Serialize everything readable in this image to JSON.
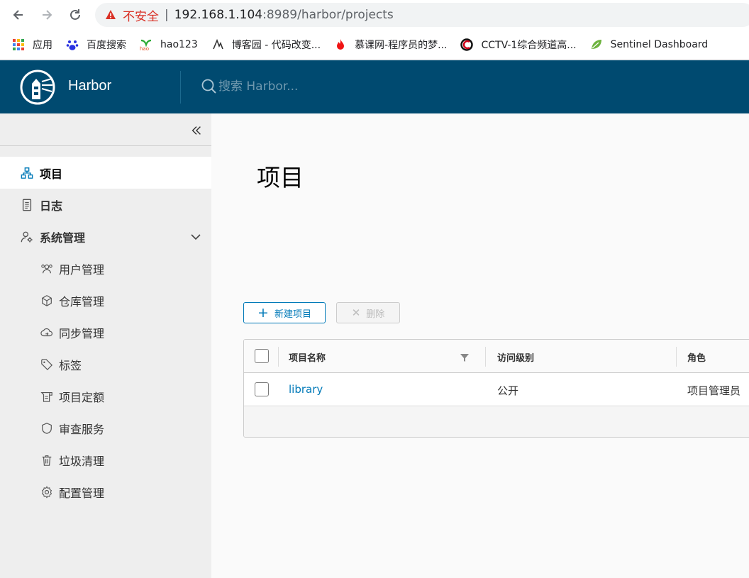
{
  "browser": {
    "insecure_label": "不安全",
    "url_host": "192.168.1.104",
    "url_rest": ":8989/harbor/projects",
    "bookmarks": [
      {
        "label": "应用",
        "icon": "apps-grid-icon"
      },
      {
        "label": "百度搜索",
        "icon": "baidu-paw-icon"
      },
      {
        "label": "hao123",
        "icon": "hao123-icon"
      },
      {
        "label": "博客园 - 代码改变...",
        "icon": "cnblogs-icon"
      },
      {
        "label": "慕课网-程序员的梦...",
        "icon": "imooc-flame-icon"
      },
      {
        "label": "CCTV-1综合频道高...",
        "icon": "cctv-icon"
      },
      {
        "label": "Sentinel Dashboard",
        "icon": "sentinel-leaf-icon"
      }
    ]
  },
  "header": {
    "brand": "Harbor",
    "search_placeholder": "搜索 Harbor..."
  },
  "sidebar": {
    "items": [
      {
        "label": "项目",
        "icon": "project-tree-icon",
        "active": true
      },
      {
        "label": "日志",
        "icon": "log-document-icon"
      },
      {
        "label": "系统管理",
        "icon": "admin-user-gear-icon",
        "expanded": true
      }
    ],
    "sub_items": [
      {
        "label": "用户管理",
        "icon": "users-icon"
      },
      {
        "label": "仓库管理",
        "icon": "registry-box-icon"
      },
      {
        "label": "同步管理",
        "icon": "cloud-sync-icon"
      },
      {
        "label": "标签",
        "icon": "tag-icon"
      },
      {
        "label": "项目定额",
        "icon": "quota-icon"
      },
      {
        "label": "审查服务",
        "icon": "shield-icon"
      },
      {
        "label": "垃圾清理",
        "icon": "trash-icon"
      },
      {
        "label": "配置管理",
        "icon": "gear-icon"
      }
    ]
  },
  "main": {
    "title": "项目",
    "new_button": "新建项目",
    "delete_button": "删除",
    "columns": [
      "项目名称",
      "访问级别",
      "角色"
    ],
    "rows": [
      {
        "name": "library",
        "access": "公开",
        "role": "项目管理员"
      }
    ]
  },
  "colors": {
    "header_bg": "#004a70",
    "accent": "#0079b8",
    "sidebar_bg": "#eeeeee"
  }
}
